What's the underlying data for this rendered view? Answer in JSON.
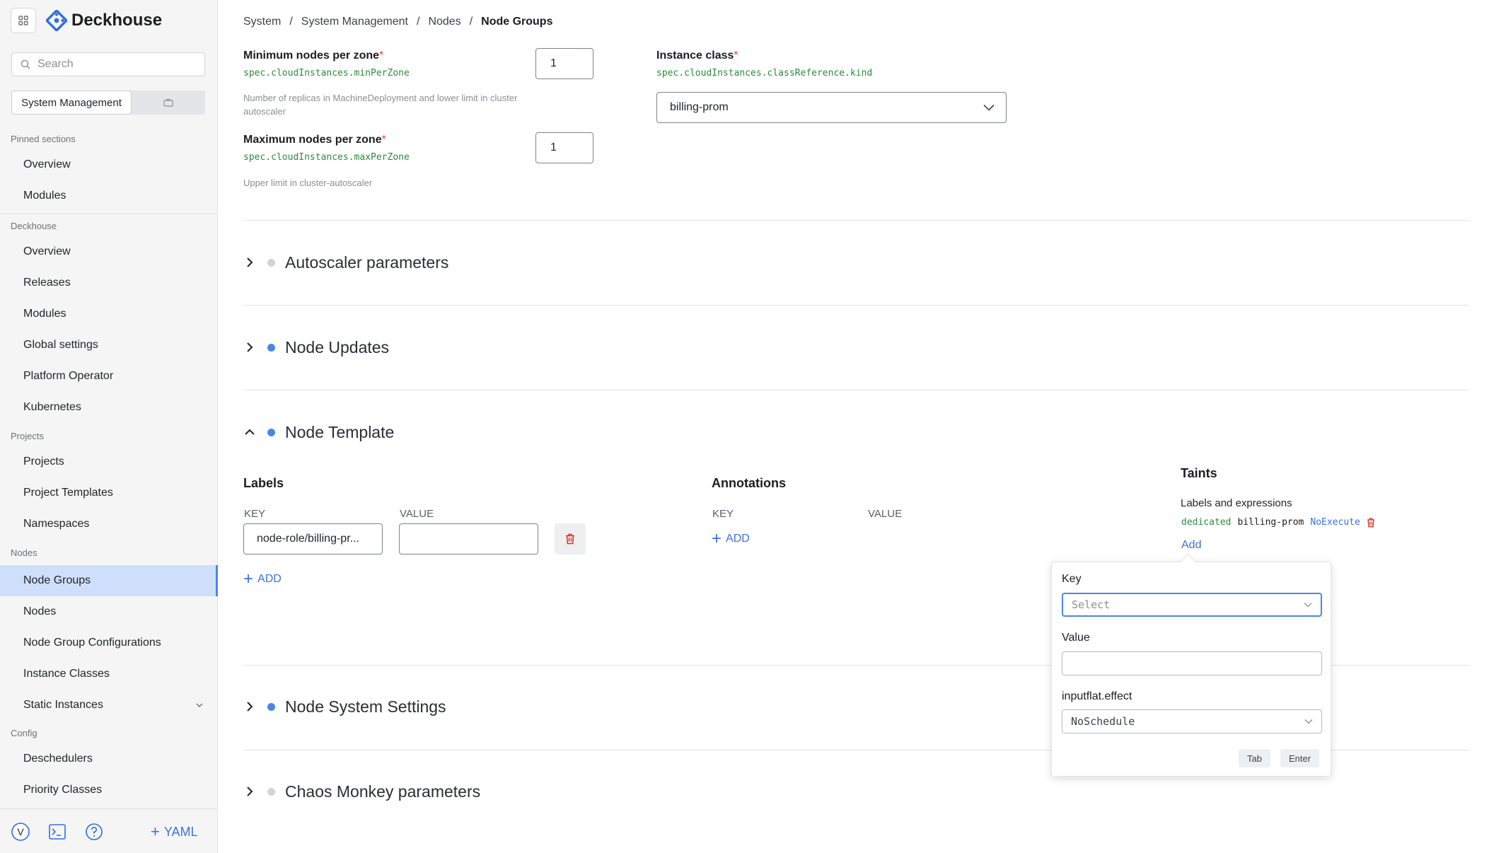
{
  "app": {
    "name": "Deckhouse"
  },
  "sidebar": {
    "search_placeholder": "Search",
    "scope_label": "System Management",
    "sections": {
      "pinned": "Pinned sections",
      "deckhouse": "Deckhouse",
      "projects": "Projects",
      "nodes": "Nodes",
      "config": "Config"
    },
    "pinned_items": [
      "Overview",
      "Modules"
    ],
    "deckhouse_items": [
      "Overview",
      "Releases",
      "Modules",
      "Global settings",
      "Platform Operator",
      "Kubernetes"
    ],
    "projects_items": [
      "Projects",
      "Project Templates",
      "Namespaces"
    ],
    "nodes_items": [
      "Node Groups",
      "Nodes",
      "Node Group Configurations",
      "Instance Classes",
      "Static Instances"
    ],
    "config_items": [
      "Deschedulers",
      "Priority Classes"
    ],
    "active_item": "Node Groups",
    "avatar_letter": "V",
    "yaml_label": "YAML"
  },
  "breadcrumb": [
    "System",
    "System Management",
    "Nodes",
    "Node Groups"
  ],
  "form": {
    "min_nodes": {
      "label": "Minimum nodes per zone",
      "path": "spec.cloudInstances.minPerZone",
      "hint": "Number of replicas in MachineDeployment and lower limit in cluster autoscaler",
      "value": "1"
    },
    "max_nodes": {
      "label": "Maximum nodes per zone",
      "path": "spec.cloudInstances.maxPerZone",
      "hint": "Upper limit in cluster-autoscaler",
      "value": "1"
    },
    "instance_class": {
      "label": "Instance class",
      "path": "spec.cloudInstances.classReference.kind",
      "value": "billing-prom"
    }
  },
  "sections": [
    {
      "title": "Autoscaler parameters",
      "expanded": false,
      "dot": "#d0d3d9"
    },
    {
      "title": "Node Updates",
      "expanded": false,
      "dot": "#4a86e8"
    },
    {
      "title": "Node Template",
      "expanded": true,
      "dot": "#4a86e8"
    },
    {
      "title": "Node System Settings",
      "expanded": false,
      "dot": "#4a86e8"
    },
    {
      "title": "Chaos Monkey parameters",
      "expanded": false,
      "dot": "#d0d3d9"
    }
  ],
  "node_template": {
    "labels": {
      "title": "Labels",
      "key_header": "KEY",
      "value_header": "VALUE",
      "key_value": "node-role/billing-pr...",
      "value_value": "",
      "add_label": "ADD"
    },
    "annotations": {
      "title": "Annotations",
      "key_header": "KEY",
      "value_header": "VALUE",
      "add_label": "ADD"
    },
    "taints": {
      "title": "Taints",
      "subtitle": "Labels and expressions",
      "existing": {
        "key": "dedicated",
        "value": "billing-prom",
        "effect": "NoExecute"
      },
      "add_label": "Add"
    }
  },
  "taint_popover": {
    "key_label": "Key",
    "key_placeholder": "Select",
    "value_label": "Value",
    "value_value": "",
    "effect_label": "inputflat.effect",
    "effect_value": "NoSchedule",
    "tab_label": "Tab",
    "enter_label": "Enter"
  },
  "colors": {
    "accent": "#3b72d9",
    "active_bg": "#cfdffb",
    "path_green": "#2b8a3e",
    "required": "#e0443b",
    "delete_red": "#d93025"
  }
}
